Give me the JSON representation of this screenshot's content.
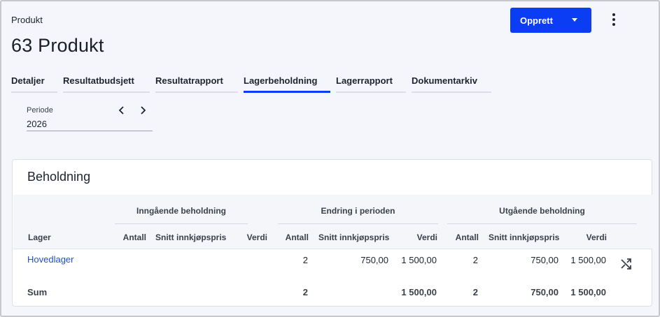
{
  "header": {
    "breadcrumb": "Produkt",
    "title": "63 Produkt",
    "create_label": "Opprett"
  },
  "tabs": [
    {
      "label": "Detaljer",
      "active": false
    },
    {
      "label": "Resultatbudsjett",
      "active": false
    },
    {
      "label": "Resultatrapport",
      "active": false
    },
    {
      "label": "Lagerbeholdning",
      "active": true
    },
    {
      "label": "Lagerrapport",
      "active": false
    },
    {
      "label": "Dokumentarkiv",
      "active": false
    }
  ],
  "period": {
    "label": "Periode",
    "value": "2026"
  },
  "card": {
    "title": "Beholdning",
    "groups": [
      "Inngående beholdning",
      "Endring i perioden",
      "Utgående beholdning"
    ],
    "columns": {
      "lager": "Lager",
      "antall": "Antall",
      "snitt": "Snitt innkjøpspris",
      "verdi": "Verdi"
    },
    "rows": [
      {
        "lager": "Hovedlager",
        "in_antall": "",
        "in_snitt": "",
        "in_verdi": "",
        "ch_antall": "2",
        "ch_snitt": "750,00",
        "ch_verdi": "1 500,00",
        "out_antall": "2",
        "out_snitt": "750,00",
        "out_verdi": "1 500,00"
      }
    ],
    "sum": {
      "label": "Sum",
      "in_antall": "",
      "in_snitt": "",
      "in_verdi": "",
      "ch_antall": "2",
      "ch_snitt": "",
      "ch_verdi": "1 500,00",
      "out_antall": "2",
      "out_snitt": "750,00",
      "out_verdi": "1 500,00"
    }
  },
  "colors": {
    "accent": "#0b3df5",
    "link": "#1d4fd8",
    "background": "#f4f6fb"
  },
  "icons": {
    "more": "more-vertical-icon",
    "prev": "chevron-left-icon",
    "next": "chevron-right-icon",
    "dropdown": "caret-down-icon",
    "row_action": "shuffle-icon"
  }
}
